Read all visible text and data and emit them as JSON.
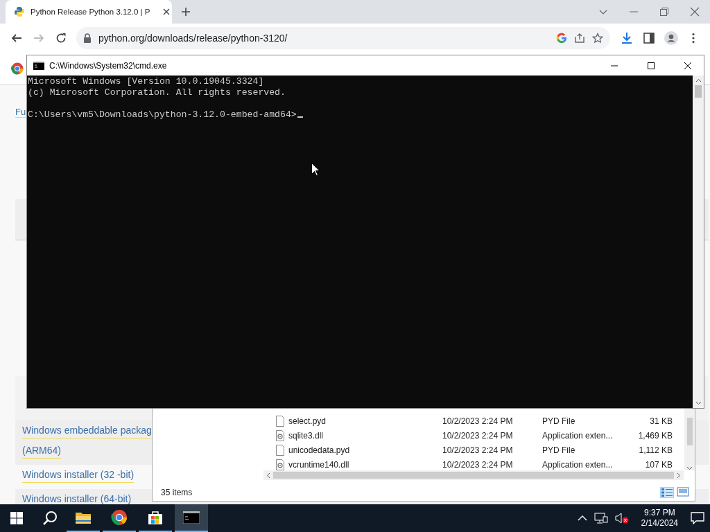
{
  "browser": {
    "tab_title": "Python Release Python 3.12.0 | P",
    "url": "python.org/downloads/release/python-3120/",
    "page": {
      "breadcrumb": "Fu",
      "rows": [
        {
          "lines": [
            "Windows embeddable packag",
            "(ARM64)"
          ]
        },
        {
          "lines": [
            "Windows installer (32 -bit)"
          ]
        },
        {
          "lines": [
            "Windows installer (64-bit)"
          ]
        }
      ]
    }
  },
  "explorer": {
    "files": [
      {
        "name": "select.pyd",
        "date": "10/2/2023 2:24 PM",
        "type": "PYD File",
        "size": "31 KB",
        "kind": "pyd"
      },
      {
        "name": "sqlite3.dll",
        "date": "10/2/2023 2:24 PM",
        "type": "Application exten...",
        "size": "1,469 KB",
        "kind": "dll"
      },
      {
        "name": "unicodedata.pyd",
        "date": "10/2/2023 2:24 PM",
        "type": "PYD File",
        "size": "1,112 KB",
        "kind": "pyd"
      },
      {
        "name": "vcruntime140.dll",
        "date": "10/2/2023 2:24 PM",
        "type": "Application exten...",
        "size": "107 KB",
        "kind": "dll"
      }
    ],
    "status": "35 items"
  },
  "cmd": {
    "title": "C:\\Windows\\System32\\cmd.exe",
    "banner": [
      "Microsoft Windows [Version 10.0.19045.3324]",
      "(c) Microsoft Corporation. All rights reserved."
    ],
    "prompt": "C:\\Users\\vm5\\Downloads\\python-3.12.0-embed-amd64>"
  },
  "taskbar": {
    "apps": [
      {
        "kind": "explorer",
        "running": true,
        "selected": false
      },
      {
        "kind": "chrome",
        "running": true,
        "selected": false
      },
      {
        "kind": "store",
        "running": true,
        "selected": false
      },
      {
        "kind": "terminal",
        "running": true,
        "selected": true
      }
    ],
    "time": "9:37 PM",
    "date": "2/14/2024"
  }
}
